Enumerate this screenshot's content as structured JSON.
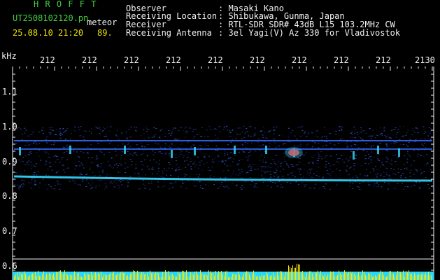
{
  "header": {
    "app_name": "H R O F F T",
    "file_name": "UT2508102120.pn",
    "type_label": "meteor",
    "date_time": "25.08.10 21:20",
    "count": "89.",
    "fields": [
      {
        "label": "Observer",
        "value": ": Masaki Kano"
      },
      {
        "label": "Receiving Location",
        "value": ": Shibukawa, Gunma, Japan"
      },
      {
        "label": "Receiver",
        "value": ": RTL-SDR SDR# 43dB L15 103.2MHz CW"
      },
      {
        "label": "Receiving Antenna",
        "value": ": 3el Yagi(V) Az 330 for Vladivostok"
      }
    ]
  },
  "time_axis": {
    "labels": [
      "212",
      "212",
      "212",
      "212",
      "212",
      "212",
      "212",
      "212",
      "212",
      "2130"
    ]
  },
  "freq_axis": {
    "unit": "kHz",
    "labels": [
      "1.1",
      "1.0",
      "0.9",
      "0.8",
      "0.7",
      "0.6"
    ]
  },
  "colors": {
    "header_green": "#41d241",
    "text_white": "#f2f2f2",
    "time_yellow": "#e8e000",
    "signal_blue": "#3a6cff",
    "signal_cyan": "#37d8ff",
    "echo_red": "#ff3030",
    "level_yellow": "#ffe800",
    "level_cyan": "#22d8ff"
  }
}
